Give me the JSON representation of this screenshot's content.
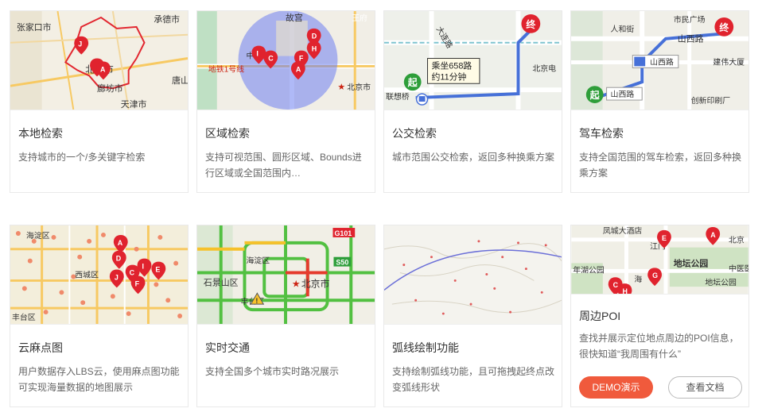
{
  "cards": [
    {
      "title": "本地检索",
      "desc": "支持城市的一个/多关键字检索",
      "map_labels": [
        "张家口市",
        "承德市",
        "北京市",
        "廊坊市",
        "天津市",
        "唐山市"
      ],
      "map_icons": [
        "map-pin-icon"
      ]
    },
    {
      "title": "区域检索",
      "desc": "支持可视范围、圆形区域、Bounds进行区域或全国范围内…",
      "map_labels": [
        "故宫",
        "中山公",
        "地铁1号线",
        "北京市",
        "王府"
      ],
      "map_icons": [
        "map-pin-icon",
        "star-icon"
      ]
    },
    {
      "title": "公交检索",
      "desc": "城市范围公交检索，返回多种换乘方案",
      "map_labels": [
        "大连路",
        "乘坐658路",
        "约11分钟",
        "北京电",
        "联想桥"
      ],
      "markers": {
        "start": "起",
        "end": "终"
      },
      "map_icons": [
        "bus-icon"
      ]
    },
    {
      "title": "驾车检索",
      "desc": "支持全国范围的驾车检索，返回多种换乘方案",
      "map_labels": [
        "市民广场",
        "人和街",
        "山西路",
        "山西路",
        "山西路",
        "建伟大厦",
        "创新印刷厂"
      ],
      "markers": {
        "start": "起",
        "end": "终"
      },
      "map_icons": [
        "car-icon"
      ]
    },
    {
      "title": "云麻点图",
      "desc": "用户数据存入LBS云，使用麻点图功能可实现海量数据的地图展示",
      "map_labels": [
        "海淀区",
        "西城区",
        "丰台区"
      ],
      "map_icons": [
        "map-pin-icon"
      ]
    },
    {
      "title": "实时交通",
      "desc": "支持全国多个城市实时路况展示",
      "map_labels": [
        "G101",
        "海淀区",
        "石景山区",
        "北京市",
        "S50",
        "丰台区"
      ],
      "map_icons": [
        "warning-icon",
        "star-icon"
      ]
    },
    {
      "title": "弧线绘制功能",
      "desc": "支持绘制弧线功能，且可拖拽起终点改变弧线形状",
      "map_labels": [],
      "map_icons": []
    },
    {
      "title": "周边POI",
      "desc": "查找并展示定位地点周边的POI信息，很快知道“我周围有什么”",
      "map_labels": [
        "凤城大酒店",
        "北京",
        "江门",
        "地坛公园",
        "中医医",
        "地坛公园",
        "海",
        "年湖公园"
      ],
      "map_icons": [
        "map-pin-icon"
      ],
      "buttons": {
        "demo": "DEMO演示",
        "doc": "查看文档"
      }
    }
  ],
  "colors": {
    "accent": "#f05a3c",
    "pin_red": "#e0232e",
    "traffic_green": "#52c041",
    "traffic_yellow": "#f6c12b",
    "traffic_red": "#e53b2d"
  }
}
